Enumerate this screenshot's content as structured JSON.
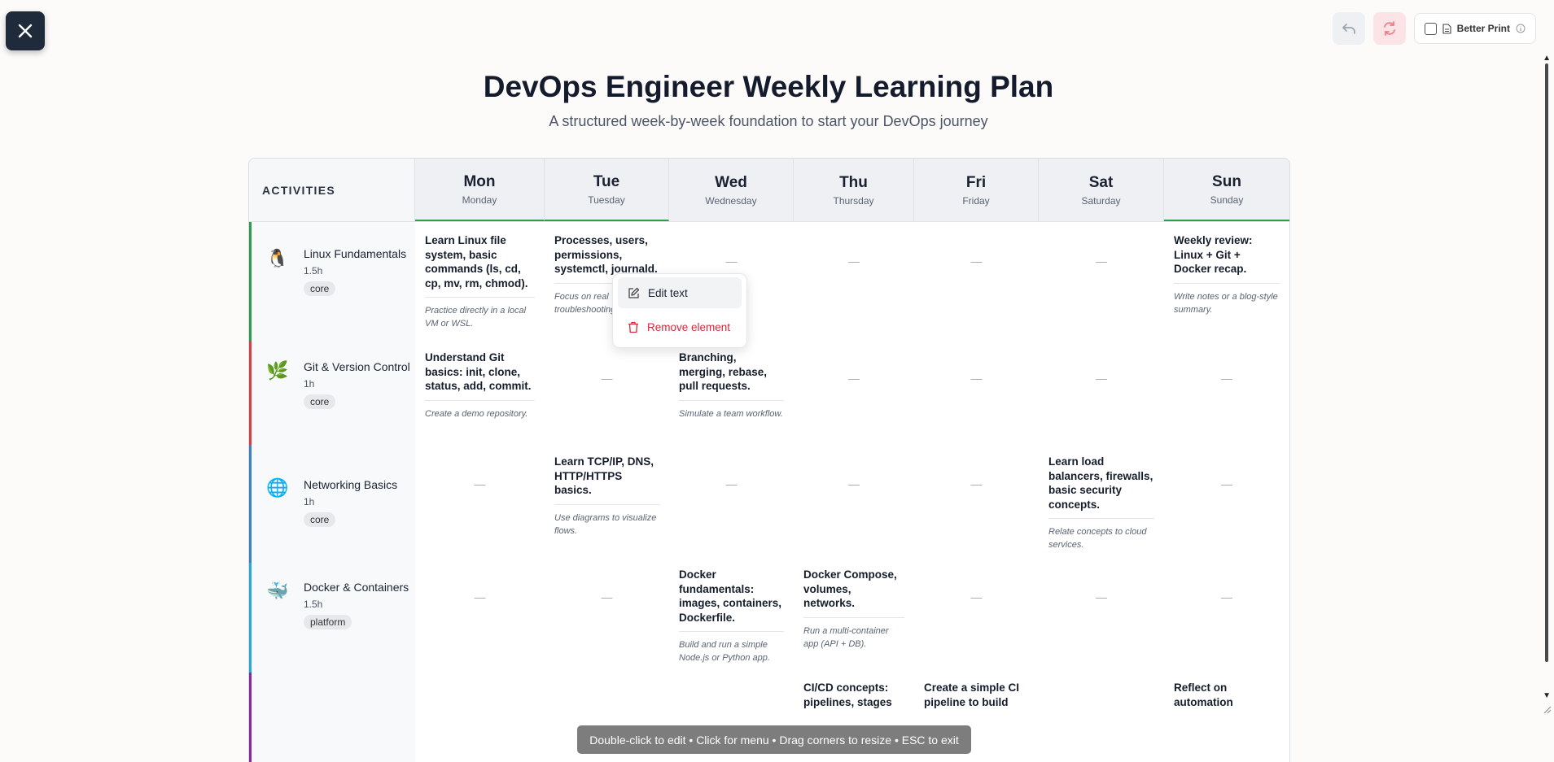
{
  "toolbar": {
    "better_print_label": "Better Print"
  },
  "page": {
    "title": "DevOps Engineer Weekly Learning Plan",
    "subtitle": "A structured week-by-week foundation to start your DevOps journey"
  },
  "table": {
    "activities_header": "ACTIVITIES",
    "days": [
      {
        "short": "Mon",
        "long": "Monday"
      },
      {
        "short": "Tue",
        "long": "Tuesday"
      },
      {
        "short": "Wed",
        "long": "Wednesday"
      },
      {
        "short": "Thu",
        "long": "Thursday"
      },
      {
        "short": "Fri",
        "long": "Friday"
      },
      {
        "short": "Sat",
        "long": "Saturday"
      },
      {
        "short": "Sun",
        "long": "Sunday"
      }
    ],
    "empty_marker": "—",
    "rows": [
      {
        "name": "Linux Fundamentals",
        "duration": "1.5h",
        "tag": "core",
        "icon": "penguin-icon",
        "color": "#2e9e4e",
        "cells": [
          {
            "main": "Learn Linux file system, basic commands (ls, cd, cp, mv, rm, chmod).",
            "note": "Practice directly in a local VM or WSL."
          },
          {
            "main": "Processes, users, permissions, systemctl, journald.",
            "note": "Focus on real troubleshooting."
          },
          null,
          null,
          null,
          null,
          {
            "main": "Weekly review: Linux + Git + Docker recap.",
            "note": "Write notes or a blog-style summary."
          }
        ]
      },
      {
        "name": "Git & Version Control",
        "duration": "1h",
        "tag": "core",
        "icon": "branch-icon",
        "color": "#d94040",
        "cells": [
          {
            "main": "Understand Git basics: init, clone, status, add, commit.",
            "note": "Create a demo repository."
          },
          null,
          {
            "main": "Branching, merging, rebase, pull requests.",
            "note": "Simulate a team workflow."
          },
          null,
          null,
          null,
          null
        ]
      },
      {
        "name": "Networking Basics",
        "duration": "1h",
        "tag": "core",
        "icon": "globe-icon",
        "color": "#3b82c4",
        "cells": [
          null,
          {
            "main": "Learn TCP/IP, DNS, HTTP/HTTPS basics.",
            "note": "Use diagrams to visualize flows."
          },
          null,
          null,
          null,
          {
            "main": "Learn load balancers, firewalls, basic security concepts.",
            "note": "Relate concepts to cloud services."
          },
          null
        ]
      },
      {
        "name": "Docker & Containers",
        "duration": "1.5h",
        "tag": "platform",
        "icon": "whale-icon",
        "color": "#2aa8d6",
        "cells": [
          null,
          null,
          {
            "main": "Docker fundamentals: images, containers, Dockerfile.",
            "note": "Build and run a simple Node.js or Python app."
          },
          {
            "main": "Docker Compose, volumes, networks.",
            "note": "Run a multi-container app (API + DB)."
          },
          null,
          null,
          null
        ]
      },
      {
        "name": "",
        "duration": "",
        "tag": "",
        "icon": "",
        "color": "#8a2a9a",
        "cells": [
          null,
          null,
          null,
          {
            "main": "CI/CD concepts: pipelines, stages",
            "note": ""
          },
          {
            "main": "Create a simple CI pipeline to build",
            "note": ""
          },
          null,
          {
            "main": "Reflect on automation",
            "note": ""
          }
        ]
      }
    ]
  },
  "context_menu": {
    "edit_label": "Edit text",
    "remove_label": "Remove element"
  },
  "hint": "Double-click to edit • Click for menu • Drag corners to resize • ESC to exit"
}
